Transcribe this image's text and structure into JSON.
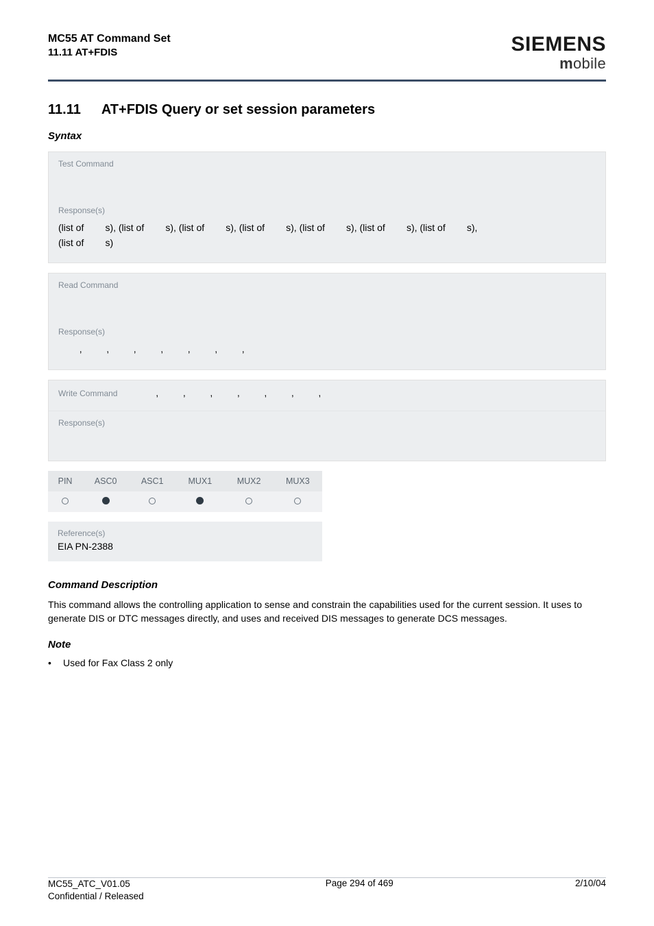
{
  "header": {
    "title_line1": "MC55 AT Command Set",
    "title_line2": "11.11 AT+FDIS",
    "brand": "SIEMENS",
    "tagline_m": "m",
    "tagline_rest": "obile"
  },
  "section": {
    "number": "11.11",
    "title": "AT+FDIS   Query or set session parameters"
  },
  "syntax_heading": "Syntax",
  "blocks": {
    "test": {
      "label": "Test Command",
      "response_label": "Response(s)",
      "response_line1": "(list of        s), (list of        s), (list of        s), (list of        s), (list of        s), (list of        s), (list of        s),",
      "response_line2": "(list of        s)"
    },
    "read": {
      "label": "Read Command",
      "response_label": "Response(s)",
      "response_body": "       ,        ,        ,        ,        ,        ,        ,"
    },
    "write": {
      "label": "Write Command",
      "inline_commas": "     ,        ,        ,        ,        ,        ,        ,",
      "response_label": "Response(s)"
    }
  },
  "mini_table": {
    "headers": [
      "PIN",
      "ASC0",
      "ASC1",
      "MUX1",
      "MUX2",
      "MUX3"
    ],
    "states": [
      "open",
      "filled",
      "open",
      "filled",
      "open",
      "open"
    ]
  },
  "reference": {
    "label": "Reference(s)",
    "value": "EIA PN-2388"
  },
  "command_description": {
    "heading": "Command Description",
    "text": "This command allows the controlling application to sense and constrain the capabilities used for the current session. It uses                to generate DIS or DTC messages directly, and uses                and received DIS messages to generate DCS messages."
  },
  "note": {
    "heading": "Note",
    "bullet": "Used for Fax Class 2 only"
  },
  "footer": {
    "left_line1": "MC55_ATC_V01.05",
    "left_line2": "Confidential / Released",
    "center": "Page 294 of 469",
    "right": "2/10/04"
  }
}
